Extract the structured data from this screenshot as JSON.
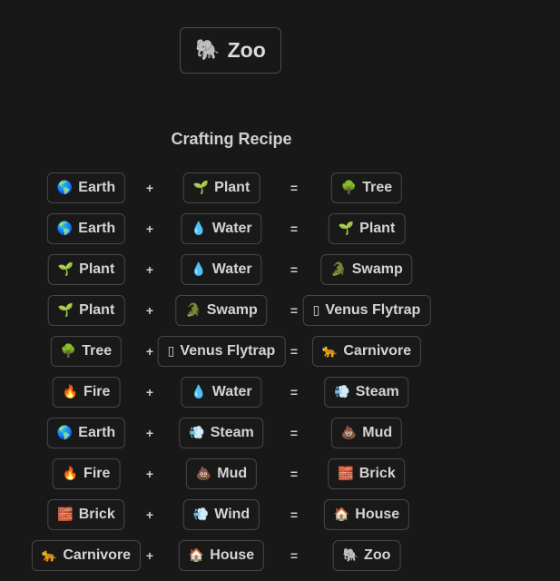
{
  "target": {
    "emoji": "🐘",
    "label": "Zoo"
  },
  "heading": "Crafting Recipe",
  "operators": {
    "plus": "+",
    "equals": "="
  },
  "recipes": [
    {
      "a": {
        "emoji": "🌎",
        "label": "Earth"
      },
      "b": {
        "emoji": "🌱",
        "label": "Plant"
      },
      "result": {
        "emoji": "🌳",
        "label": "Tree"
      }
    },
    {
      "a": {
        "emoji": "🌎",
        "label": "Earth"
      },
      "b": {
        "emoji": "💧",
        "label": "Water"
      },
      "result": {
        "emoji": "🌱",
        "label": "Plant"
      }
    },
    {
      "a": {
        "emoji": "🌱",
        "label": "Plant"
      },
      "b": {
        "emoji": "💧",
        "label": "Water"
      },
      "result": {
        "emoji": "🐊",
        "label": "Swamp"
      }
    },
    {
      "a": {
        "emoji": "🌱",
        "label": "Plant"
      },
      "b": {
        "emoji": "🐊",
        "label": "Swamp"
      },
      "result": {
        "emoji": "▯",
        "label": "Venus Flytrap"
      }
    },
    {
      "a": {
        "emoji": "🌳",
        "label": "Tree"
      },
      "b": {
        "emoji": "▯",
        "label": "Venus Flytrap"
      },
      "result": {
        "emoji": "🐆",
        "label": "Carnivore"
      }
    },
    {
      "a": {
        "emoji": "🔥",
        "label": "Fire"
      },
      "b": {
        "emoji": "💧",
        "label": "Water"
      },
      "result": {
        "emoji": "💨",
        "label": "Steam"
      }
    },
    {
      "a": {
        "emoji": "🌎",
        "label": "Earth"
      },
      "b": {
        "emoji": "💨",
        "label": "Steam"
      },
      "result": {
        "emoji": "💩",
        "label": "Mud"
      }
    },
    {
      "a": {
        "emoji": "🔥",
        "label": "Fire"
      },
      "b": {
        "emoji": "💩",
        "label": "Mud"
      },
      "result": {
        "emoji": "🧱",
        "label": "Brick"
      }
    },
    {
      "a": {
        "emoji": "🧱",
        "label": "Brick"
      },
      "b": {
        "emoji": "💨",
        "label": "Wind"
      },
      "result": {
        "emoji": "🏠",
        "label": "House"
      }
    },
    {
      "a": {
        "emoji": "🐆",
        "label": "Carnivore"
      },
      "b": {
        "emoji": "🏠",
        "label": "House"
      },
      "result": {
        "emoji": "🐘",
        "label": "Zoo"
      }
    }
  ]
}
